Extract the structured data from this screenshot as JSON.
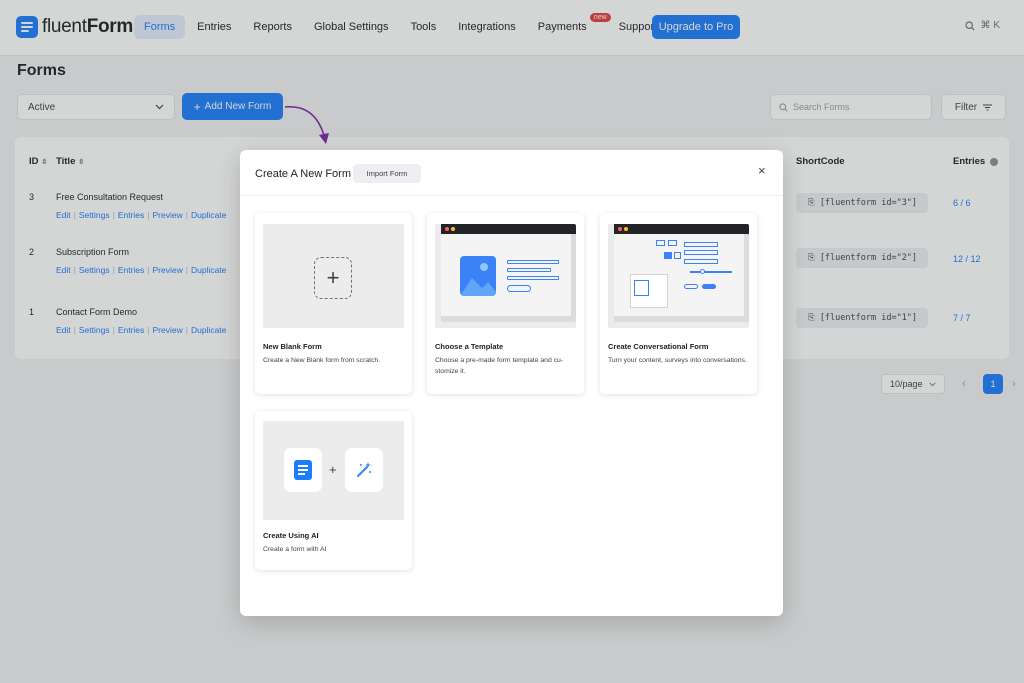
{
  "brand": {
    "name_light": "fluent",
    "name_bold": "Forms"
  },
  "nav": {
    "items": [
      {
        "label": "Forms",
        "active": true
      },
      {
        "label": "Entries"
      },
      {
        "label": "Reports"
      },
      {
        "label": "Global Settings"
      },
      {
        "label": "Tools"
      },
      {
        "label": "Integrations"
      },
      {
        "label": "Payments",
        "badge": "new"
      },
      {
        "label": "Support"
      }
    ],
    "upgrade_label": "Upgrade to Pro",
    "shortcut": "⌘ K"
  },
  "page": {
    "title": "Forms",
    "status_filter": "Active",
    "add_button": "Add New Form",
    "search_placeholder": "Search Forms",
    "filter_label": "Filter"
  },
  "table": {
    "columns": {
      "id": "ID",
      "title": "Title",
      "shortcode": "ShortCode",
      "entries": "Entries"
    },
    "actions": [
      "Edit",
      "Settings",
      "Entries",
      "Preview",
      "Duplicate"
    ],
    "rows": [
      {
        "id": "3",
        "title": "Free Consultation Request",
        "shortcode": "[fluentform id=\"3\"]",
        "entries": "6 / 6"
      },
      {
        "id": "2",
        "title": "Subscription Form",
        "shortcode": "[fluentform id=\"2\"]",
        "entries": "12 / 12"
      },
      {
        "id": "1",
        "title": "Contact Form Demo",
        "shortcode": "[fluentform id=\"1\"]",
        "entries": "7 / 7"
      }
    ]
  },
  "pagination": {
    "per_page": "10/page",
    "current_page": "1"
  },
  "modal": {
    "title": "Create A New Form",
    "import_label": "Import Form",
    "close": "×",
    "cards": [
      {
        "title": "New Blank Form",
        "desc": "Create a New Blank form from scratch."
      },
      {
        "title": "Choose a Template",
        "desc": "Choose a pre-made form template and cu- stomize it."
      },
      {
        "title": "Create Conversational Form",
        "desc": "Turn your content, surveys into conversations."
      },
      {
        "title": "Create Using AI",
        "desc": "Create a form with AI"
      }
    ]
  },
  "colors": {
    "accent": "#1a7efb",
    "badge": "#e53e3e",
    "arrow": "#6b2d8f"
  }
}
